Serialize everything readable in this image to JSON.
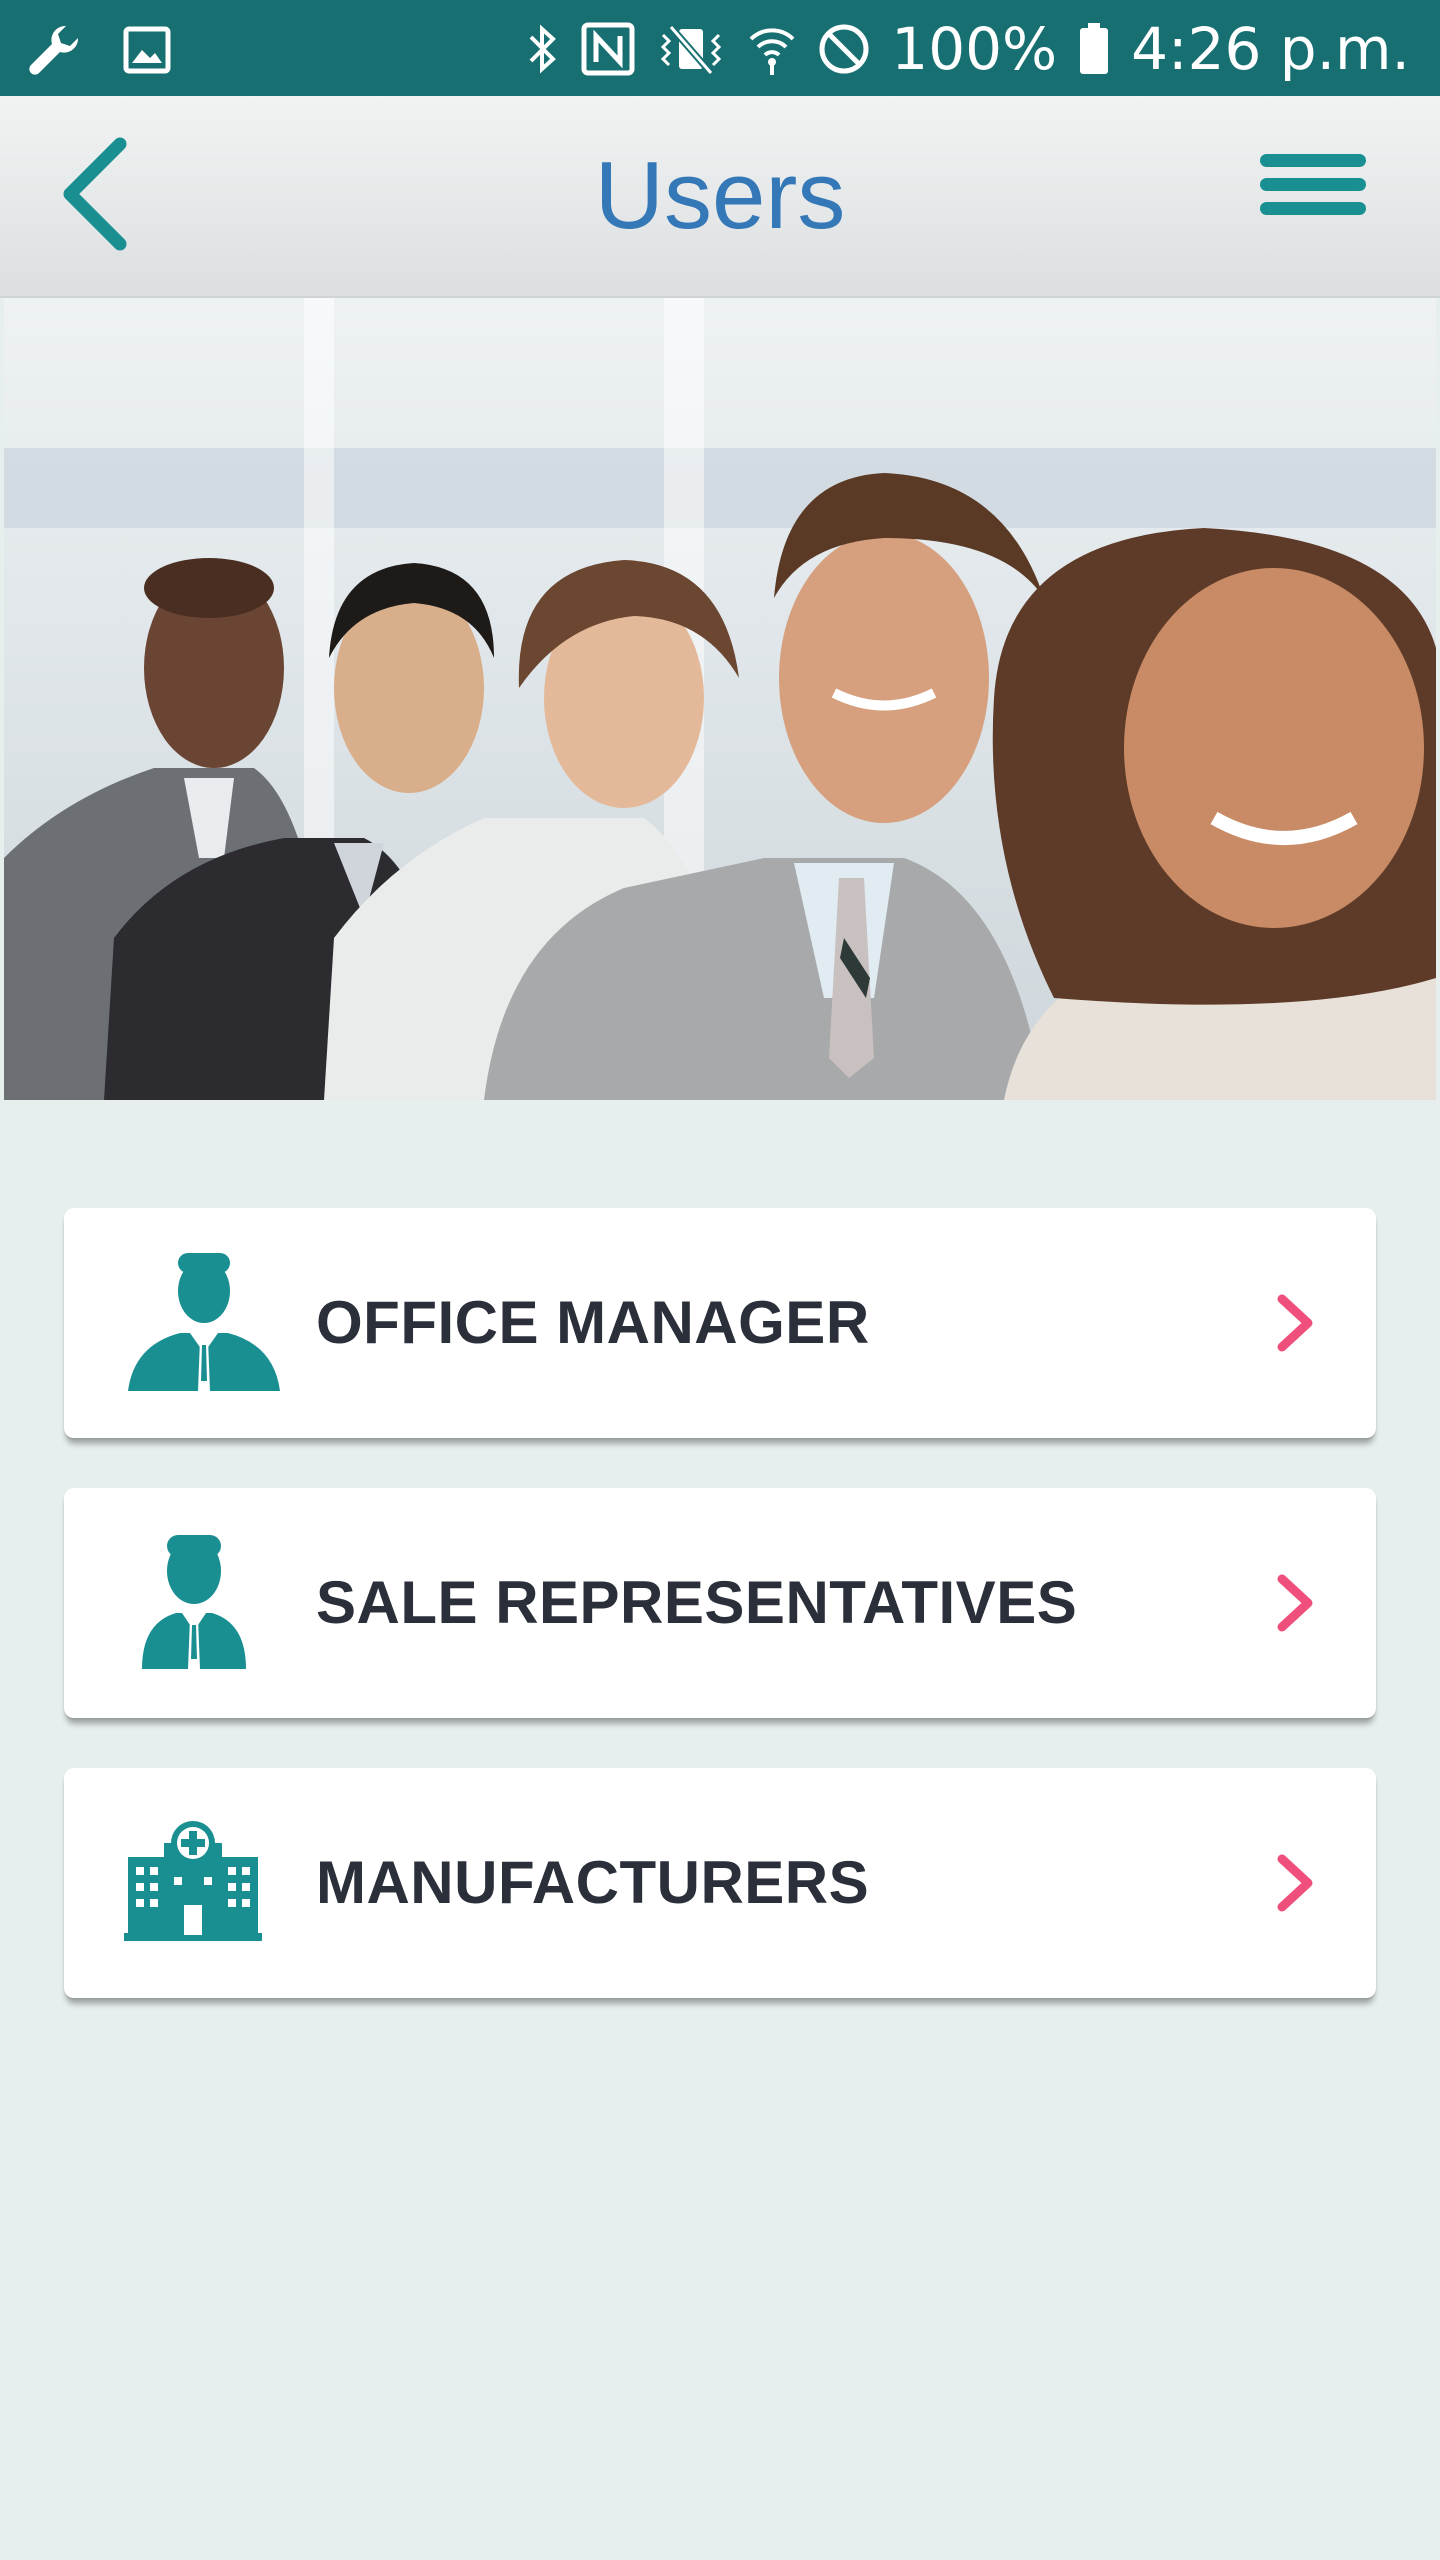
{
  "status_bar": {
    "battery": "100%",
    "time": "4:26 p.m.",
    "icons": [
      "wrench-icon",
      "image-icon",
      "bluetooth-icon",
      "nfc-icon",
      "vibrate-icon",
      "wifi-icon",
      "do-not-disturb-icon",
      "battery-icon"
    ]
  },
  "app_bar": {
    "title": "Users",
    "back_icon": "chevron-left-icon",
    "menu_icon": "hamburger-menu-icon"
  },
  "hero": {
    "image": "group-of-business-people-photo"
  },
  "menu": {
    "items": [
      {
        "label": "OFFICE MANAGER",
        "icon": "manager-icon"
      },
      {
        "label": "SALE REPRESENTATIVES",
        "icon": "representative-icon"
      },
      {
        "label": "MANUFACTURERS",
        "icon": "hospital-building-icon"
      }
    ]
  },
  "colors": {
    "status_bar": "#176f71",
    "accent_teal": "#1a8f92",
    "title_blue": "#3478b8",
    "chevron_pink": "#ef4f7b",
    "background": "#e7efee",
    "label_text": "#2b2f3a"
  }
}
